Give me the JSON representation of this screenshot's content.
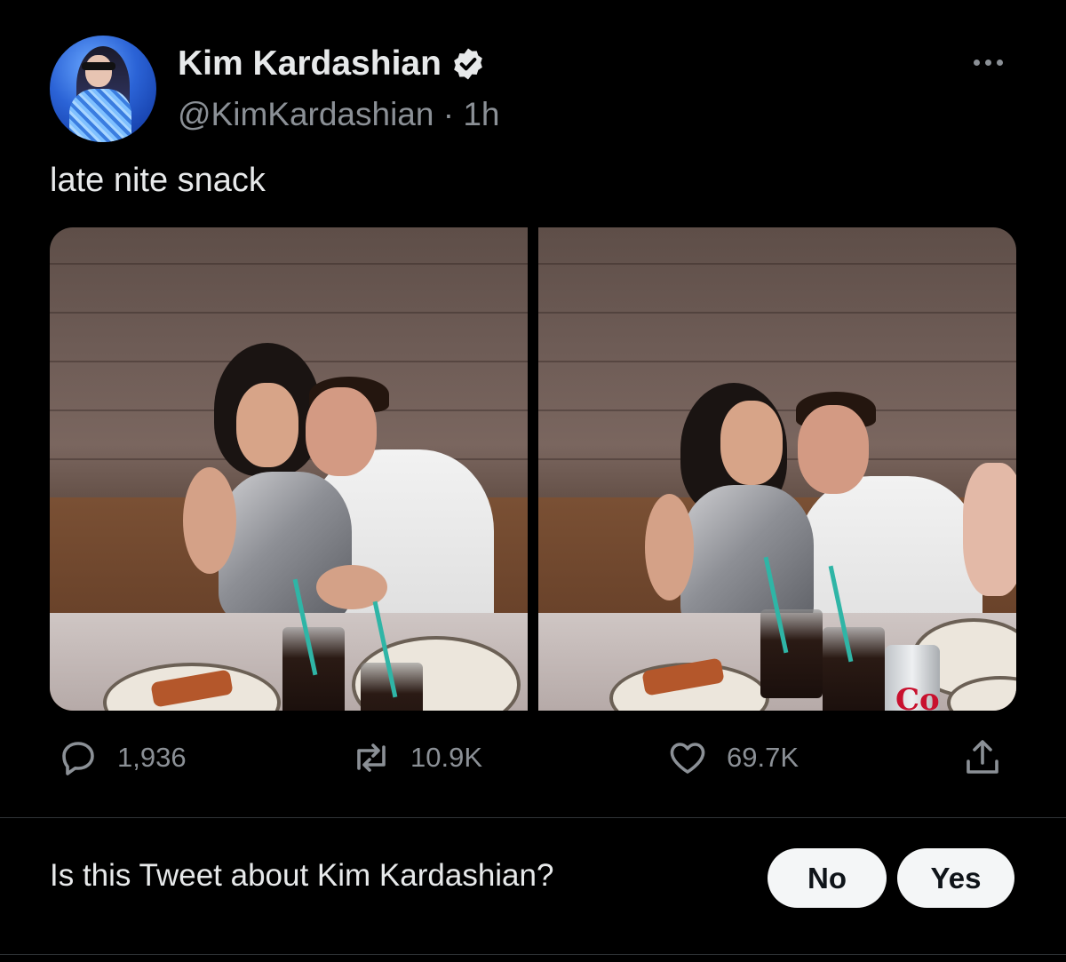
{
  "author": {
    "display_name": "Kim Kardashian",
    "handle": "@KimKardashian",
    "time": "· 1h",
    "verified": true
  },
  "tweet": {
    "text": "late nite snack",
    "media": [
      {
        "alt": ""
      },
      {
        "alt": ""
      }
    ]
  },
  "metrics": {
    "replies": "1,936",
    "retweets": "10.9K",
    "likes": "69.7K"
  },
  "feedback": {
    "question": "Is this Tweet about Kim Kardashian?",
    "no_label": "No",
    "yes_label": "Yes"
  },
  "colors": {
    "background": "#000000",
    "text_primary": "#e7e9ea",
    "text_secondary": "#8b9096",
    "button_bg": "#f4f6f7",
    "divider": "#2f3336"
  },
  "icons": {
    "more": "more-dots-icon",
    "verified": "verified-badge-icon",
    "reply": "reply-icon",
    "retweet": "retweet-icon",
    "like": "heart-icon",
    "share": "share-icon"
  }
}
